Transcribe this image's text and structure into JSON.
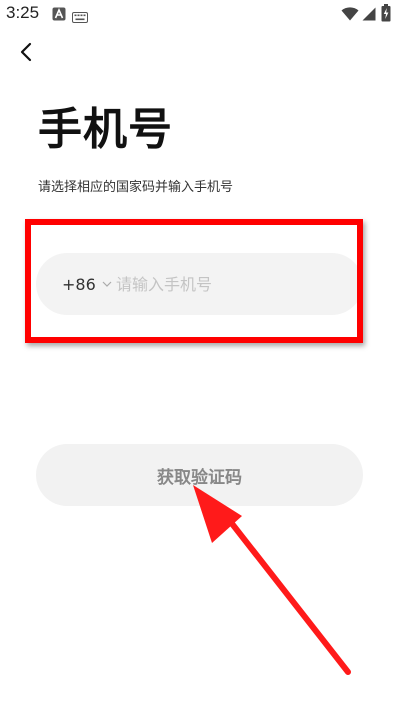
{
  "status_bar": {
    "time": "3:25",
    "icons": [
      "notification-a-icon",
      "keyboard-icon",
      "wifi-icon",
      "cell-signal-icon",
      "battery-icon"
    ]
  },
  "header": {
    "back_icon": "back-chevron-icon"
  },
  "main": {
    "title": "手机号",
    "subtitle": "请选择相应的国家码并输入手机号",
    "phone": {
      "country_code": "+86",
      "placeholder": "请输入手机号",
      "value": ""
    },
    "get_code_label": "获取验证码"
  },
  "annotations": {
    "highlight_color": "#ff0000",
    "arrow_color": "#ff1a1a"
  }
}
